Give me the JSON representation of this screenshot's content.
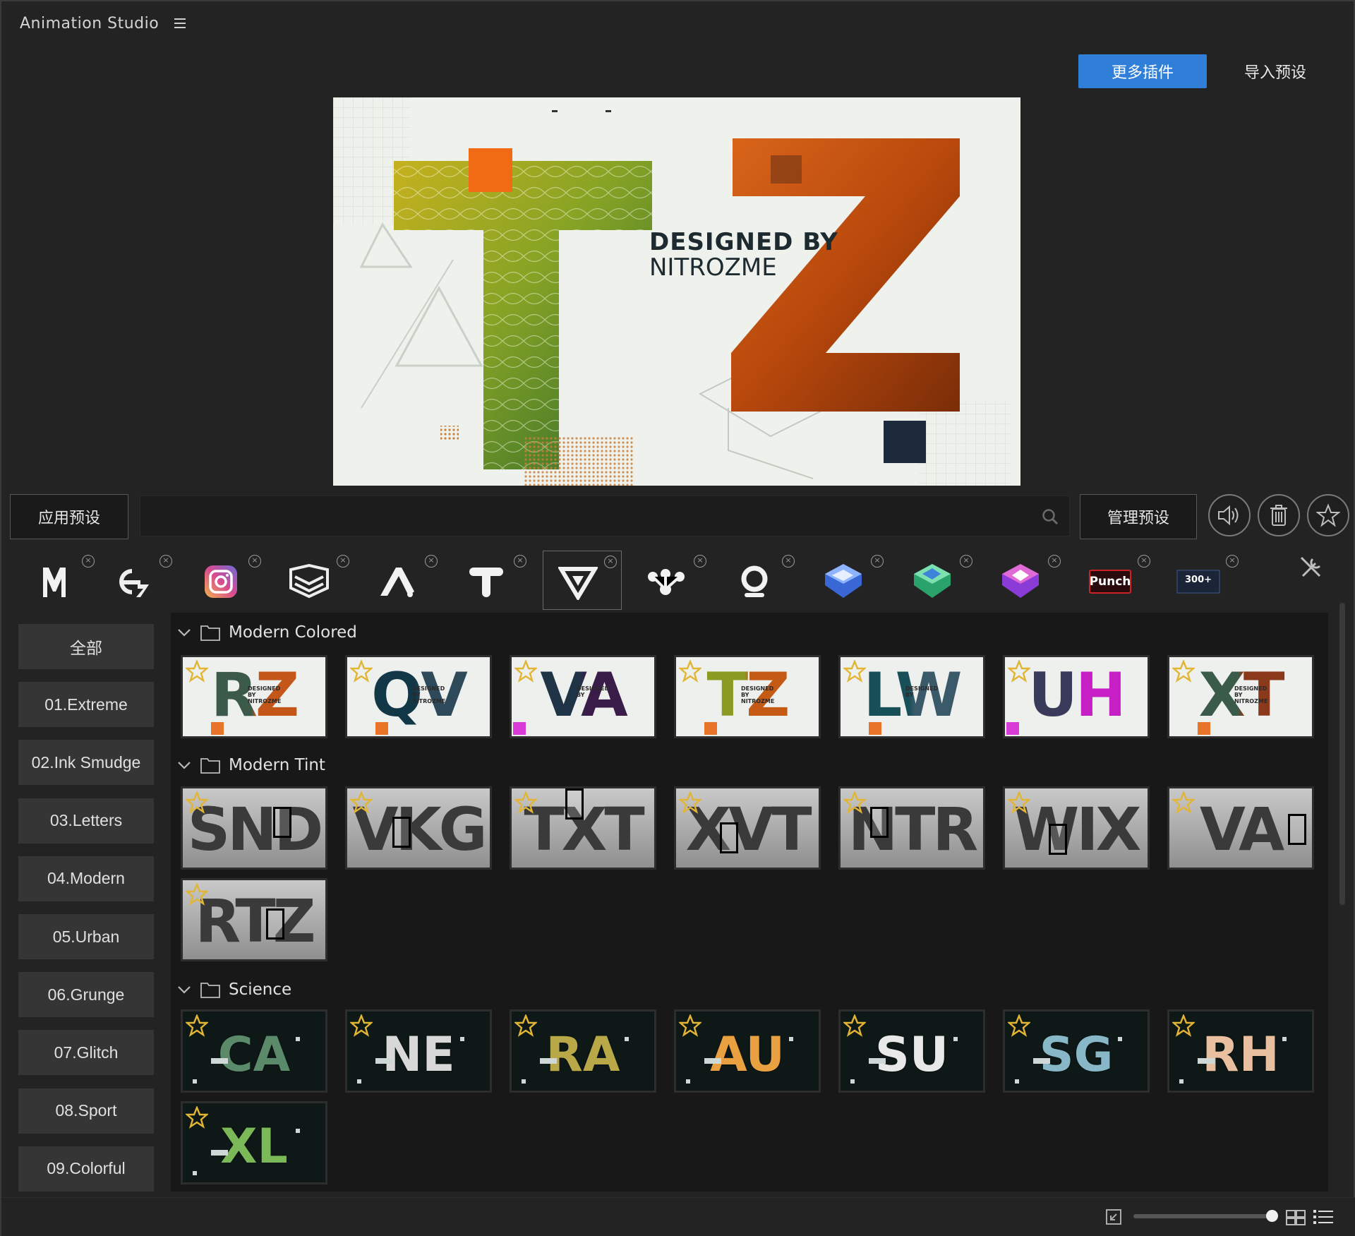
{
  "app": {
    "title": "Animation Studio"
  },
  "top_buttons": {
    "more_plugins": "更多插件",
    "import_preset": "导入预设"
  },
  "preview": {
    "caption_line1": "DESIGNED BY",
    "caption_line2": "NITROZME",
    "letters": "TZ"
  },
  "toolbar": {
    "apply_label": "应用预设",
    "manage_label": "管理预设",
    "search_value": "",
    "search_placeholder": ""
  },
  "plugins": [
    {
      "icon": "m-logo-icon",
      "label": "M"
    },
    {
      "icon": "e-logo-icon",
      "label": "E"
    },
    {
      "icon": "instagram-camera-icon",
      "label": ""
    },
    {
      "icon": "layers-stack-icon",
      "label": ""
    },
    {
      "icon": "a-logo-icon",
      "label": ""
    },
    {
      "icon": "t-logo-icon",
      "label": ""
    },
    {
      "icon": "v-triangle-logo-icon",
      "label": ""
    },
    {
      "icon": "molecule-dots-icon",
      "label": ""
    },
    {
      "icon": "o-ring-logo-icon",
      "label": ""
    },
    {
      "icon": "blue-cube-icon",
      "label": ""
    },
    {
      "icon": "green-cube-icon",
      "label": ""
    },
    {
      "icon": "purple-cube-icon",
      "label": ""
    },
    {
      "icon": "punch-logo-icon",
      "label": "Punch"
    },
    {
      "icon": "transitions-pack-icon",
      "label": "300+"
    }
  ],
  "categories": [
    "全部",
    "01.Extreme",
    "02.Ink Smudge",
    "03.Letters",
    "04.Modern",
    "05.Urban",
    "06.Grunge",
    "07.Glitch",
    "08.Sport",
    "09.Colorful"
  ],
  "groups": [
    {
      "title": "Modern Colored",
      "items": [
        {
          "text": "RZ",
          "sub": "DESIGNED BY NITROZME"
        },
        {
          "text": "QV",
          "sub": "DESIGNED BY NITROZME"
        },
        {
          "text": "VA",
          "sub": "DESIGNED BY"
        },
        {
          "text": "TZ",
          "sub": "DESIGNED BY NITROZME"
        },
        {
          "text": "LW",
          "sub": "DESIGNED BY"
        },
        {
          "text": "UH",
          "sub": ""
        },
        {
          "text": "XT",
          "sub": "DESIGNED BY NITROZME"
        }
      ]
    },
    {
      "title": "Modern Tint",
      "items": [
        {
          "text": "SND",
          "sub": ""
        },
        {
          "text": "VKG",
          "sub": ""
        },
        {
          "text": "TXT",
          "sub": ""
        },
        {
          "text": "XVT",
          "sub": ""
        },
        {
          "text": "NTR",
          "sub": ""
        },
        {
          "text": "WIX",
          "sub": ""
        },
        {
          "text": "VA",
          "sub": ""
        },
        {
          "text": "RTZ",
          "sub": ""
        }
      ]
    },
    {
      "title": "Science",
      "items": [
        {
          "text": "CA",
          "sub": ""
        },
        {
          "text": "NE",
          "sub": ""
        },
        {
          "text": "RA",
          "sub": ""
        },
        {
          "text": "AU",
          "sub": ""
        },
        {
          "text": "SU",
          "sub": ""
        },
        {
          "text": "SG",
          "sub": ""
        },
        {
          "text": "RH",
          "sub": ""
        },
        {
          "text": "XL",
          "sub": ""
        }
      ]
    }
  ],
  "status": {
    "zoom_level": 0.95
  },
  "colors": {
    "accent": "#2f7fd8",
    "star": "#e2b534",
    "background": "#232323"
  }
}
